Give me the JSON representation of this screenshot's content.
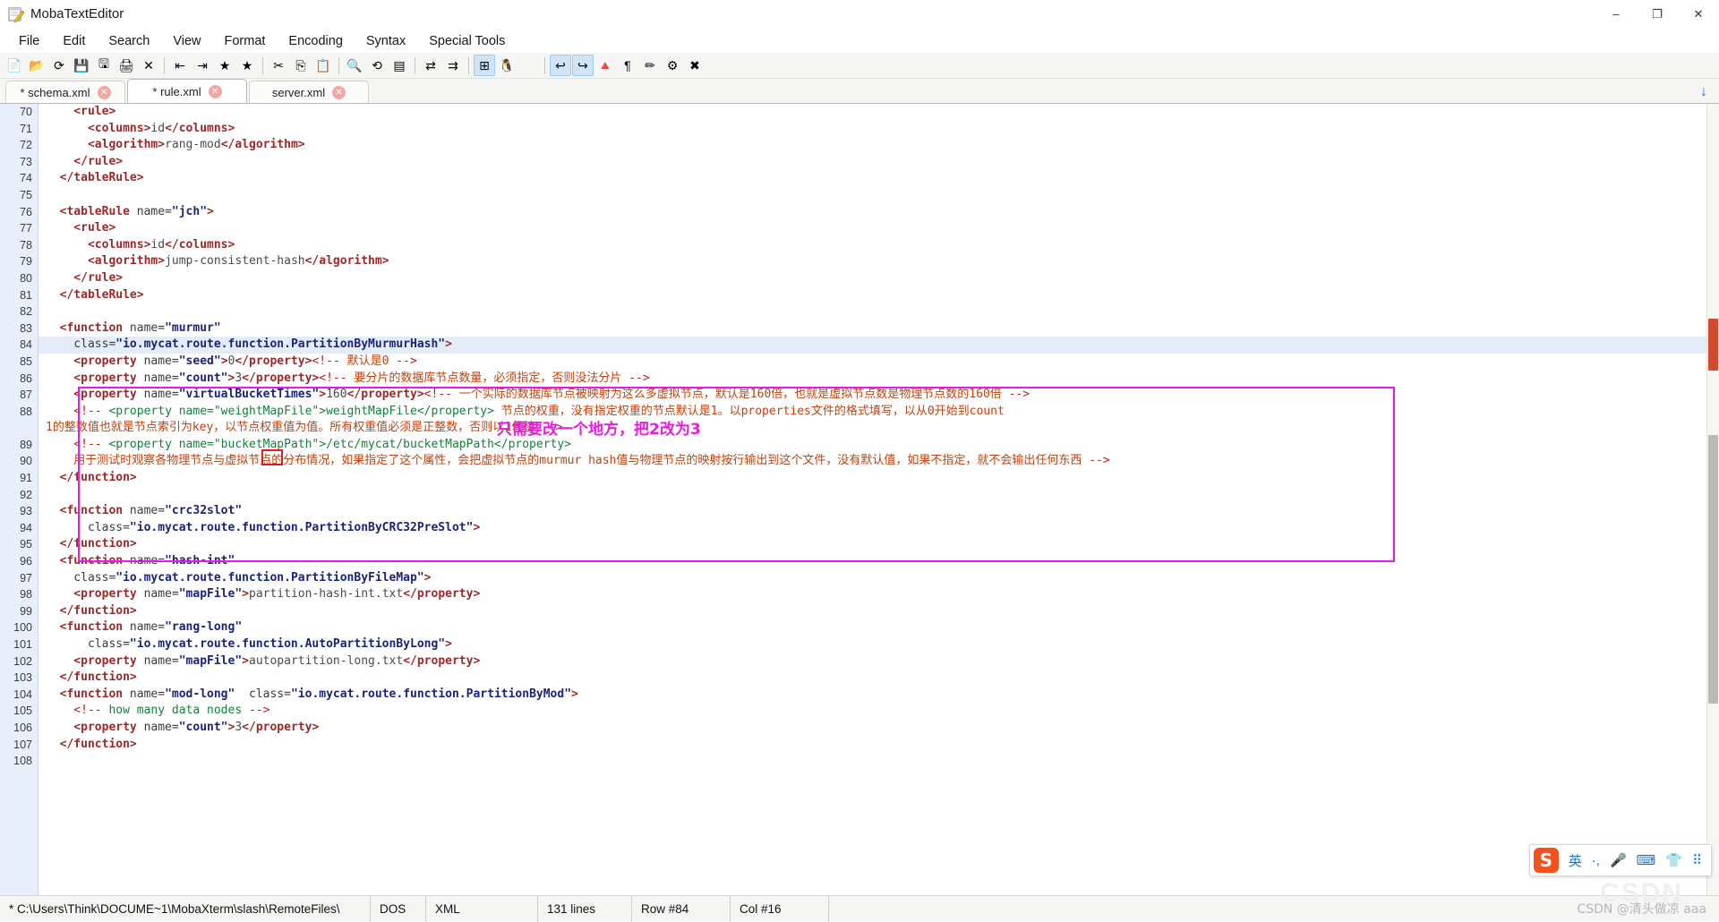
{
  "window": {
    "title": "MobaTextEditor",
    "icon": "notepad-pencil-icon",
    "minimize": "–",
    "maximize": "❐",
    "close": "✕"
  },
  "menubar": {
    "items": [
      "File",
      "Edit",
      "Search",
      "View",
      "Format",
      "Encoding",
      "Syntax",
      "Special Tools"
    ]
  },
  "toolbar": {
    "items": [
      {
        "name": "new-file-icon",
        "glyph": "📄",
        "selected": false
      },
      {
        "name": "open-folder-icon",
        "glyph": "📂",
        "selected": false
      },
      {
        "name": "reload-icon",
        "glyph": "⟳",
        "selected": false
      },
      {
        "name": "save-icon",
        "glyph": "💾",
        "selected": false
      },
      {
        "name": "save-as-icon",
        "glyph": "🖫",
        "selected": false
      },
      {
        "name": "print-icon",
        "glyph": "🖨",
        "selected": false
      },
      {
        "name": "close-file-icon",
        "glyph": "✕",
        "selected": false
      },
      {
        "name": "separator",
        "glyph": "",
        "selected": false
      },
      {
        "name": "decrease-indent-icon",
        "glyph": "⇤",
        "selected": false
      },
      {
        "name": "increase-indent-icon",
        "glyph": "⇥",
        "selected": false
      },
      {
        "name": "bookmark-toggle-icon",
        "glyph": "★",
        "selected": false
      },
      {
        "name": "bookmark-next-icon",
        "glyph": "★",
        "selected": false
      },
      {
        "name": "separator",
        "glyph": "",
        "selected": false
      },
      {
        "name": "cut-icon",
        "glyph": "✂",
        "selected": false
      },
      {
        "name": "copy-icon",
        "glyph": "⎘",
        "selected": false
      },
      {
        "name": "paste-icon",
        "glyph": "📋",
        "selected": false
      },
      {
        "name": "separator",
        "glyph": "",
        "selected": false
      },
      {
        "name": "find-icon",
        "glyph": "🔍",
        "selected": false
      },
      {
        "name": "replace-icon",
        "glyph": "⟲",
        "selected": false
      },
      {
        "name": "goto-line-icon",
        "glyph": "▤",
        "selected": false
      },
      {
        "name": "separator",
        "glyph": "",
        "selected": false
      },
      {
        "name": "compare-files-icon",
        "glyph": "⇄",
        "selected": false
      },
      {
        "name": "merge-files-icon",
        "glyph": "⇉",
        "selected": false
      },
      {
        "name": "separator",
        "glyph": "",
        "selected": false
      },
      {
        "name": "windows-format-icon",
        "glyph": "⊞",
        "selected": true
      },
      {
        "name": "linux-format-icon",
        "glyph": "🐧",
        "selected": false
      },
      {
        "name": "mac-format-icon",
        "glyph": "",
        "selected": false
      },
      {
        "name": "separator",
        "glyph": "",
        "selected": false
      },
      {
        "name": "undo-icon",
        "glyph": "↩",
        "selected": true
      },
      {
        "name": "redo-icon",
        "glyph": "↪",
        "selected": true
      },
      {
        "name": "color-picker-icon",
        "glyph": "🔺",
        "selected": false
      },
      {
        "name": "show-pilcrow-icon",
        "glyph": "¶",
        "selected": false
      },
      {
        "name": "highlight-pen-icon",
        "glyph": "✏",
        "selected": false
      },
      {
        "name": "settings-gear-icon",
        "glyph": "⚙",
        "selected": false
      },
      {
        "name": "exit-icon",
        "glyph": "✖",
        "selected": false
      }
    ]
  },
  "tabs": {
    "items": [
      {
        "label": "* schema.xml",
        "active": false,
        "closable": true
      },
      {
        "label": "* rule.xml",
        "active": true,
        "closable": true
      },
      {
        "label": "server.xml",
        "active": false,
        "closable": true
      }
    ],
    "download_icon": "↓"
  },
  "editor": {
    "first_line": 70,
    "lines": [
      {
        "n": 70,
        "current": false,
        "spans": [
          {
            "c": "t",
            "v": "    <rule>"
          }
        ]
      },
      {
        "n": 71,
        "current": false,
        "spans": [
          {
            "c": "t",
            "v": "      <columns>"
          },
          {
            "c": "txt",
            "v": "id"
          },
          {
            "c": "t",
            "v": "</columns>"
          }
        ]
      },
      {
        "n": 72,
        "current": false,
        "spans": [
          {
            "c": "t",
            "v": "      <algorithm>"
          },
          {
            "c": "txt",
            "v": "rang-mod"
          },
          {
            "c": "t",
            "v": "</algorithm>"
          }
        ]
      },
      {
        "n": 73,
        "current": false,
        "spans": [
          {
            "c": "t",
            "v": "    </rule>"
          }
        ]
      },
      {
        "n": 74,
        "current": false,
        "spans": [
          {
            "c": "t",
            "v": "  </tableRule>"
          }
        ]
      },
      {
        "n": 75,
        "current": false,
        "spans": [
          {
            "c": "plain",
            "v": ""
          }
        ]
      },
      {
        "n": 76,
        "current": false,
        "spans": [
          {
            "c": "t",
            "v": "  <tableRule "
          },
          {
            "c": "at",
            "v": "name="
          },
          {
            "c": "av",
            "v": "\"jch\""
          },
          {
            "c": "t",
            "v": ">"
          }
        ]
      },
      {
        "n": 77,
        "current": false,
        "spans": [
          {
            "c": "t",
            "v": "    <rule>"
          }
        ]
      },
      {
        "n": 78,
        "current": false,
        "spans": [
          {
            "c": "t",
            "v": "      <columns>"
          },
          {
            "c": "txt",
            "v": "id"
          },
          {
            "c": "t",
            "v": "</columns>"
          }
        ]
      },
      {
        "n": 79,
        "current": false,
        "spans": [
          {
            "c": "t",
            "v": "      <algorithm>"
          },
          {
            "c": "txt",
            "v": "jump-consistent-hash"
          },
          {
            "c": "t",
            "v": "</algorithm>"
          }
        ]
      },
      {
        "n": 80,
        "current": false,
        "spans": [
          {
            "c": "t",
            "v": "    </rule>"
          }
        ]
      },
      {
        "n": 81,
        "current": false,
        "spans": [
          {
            "c": "t",
            "v": "  </tableRule>"
          }
        ]
      },
      {
        "n": 82,
        "current": false,
        "spans": [
          {
            "c": "plain",
            "v": ""
          }
        ]
      },
      {
        "n": 83,
        "current": false,
        "spans": [
          {
            "c": "t",
            "v": "  <function "
          },
          {
            "c": "at",
            "v": "name="
          },
          {
            "c": "av",
            "v": "\"murmur\""
          }
        ]
      },
      {
        "n": 84,
        "current": true,
        "spans": [
          {
            "c": "at",
            "v": "    class="
          },
          {
            "c": "av",
            "v": "\"io.mycat.route.function.PartitionByMurmurHash\""
          },
          {
            "c": "t",
            "v": ">"
          }
        ]
      },
      {
        "n": 85,
        "current": false,
        "spans": [
          {
            "c": "t",
            "v": "    <property "
          },
          {
            "c": "at",
            "v": "name="
          },
          {
            "c": "av",
            "v": "\"seed\""
          },
          {
            "c": "t",
            "v": ">"
          },
          {
            "c": "txt",
            "v": "0"
          },
          {
            "c": "t",
            "v": "</property>"
          },
          {
            "c": "cmd",
            "v": "<!--"
          },
          {
            "c": "cm",
            "v": " 默认是0 "
          },
          {
            "c": "cmd",
            "v": "-->"
          }
        ]
      },
      {
        "n": 86,
        "current": false,
        "spans": [
          {
            "c": "t",
            "v": "    <property "
          },
          {
            "c": "at",
            "v": "name="
          },
          {
            "c": "av",
            "v": "\"count\""
          },
          {
            "c": "t",
            "v": ">"
          },
          {
            "c": "txt",
            "v": "3"
          },
          {
            "c": "t",
            "v": "</property>"
          },
          {
            "c": "cmd",
            "v": "<!--"
          },
          {
            "c": "cm",
            "v": " 要分片的数据库节点数量，必须指定，否则没法分片 "
          },
          {
            "c": "cmd",
            "v": "-->"
          }
        ]
      },
      {
        "n": 87,
        "current": false,
        "spans": [
          {
            "c": "t",
            "v": "    <property "
          },
          {
            "c": "at",
            "v": "name="
          },
          {
            "c": "av",
            "v": "\"virtualBucketTimes\""
          },
          {
            "c": "t",
            "v": ">"
          },
          {
            "c": "txt",
            "v": "160"
          },
          {
            "c": "t",
            "v": "</property>"
          },
          {
            "c": "cmd",
            "v": "<!--"
          },
          {
            "c": "cm",
            "v": " 一个实际的数据库节点被映射为这么多虚拟节点，默认是160倍，也就是虚拟节点数是物理节点数的160倍 "
          },
          {
            "c": "cmd",
            "v": "-->"
          }
        ]
      },
      {
        "n": 88,
        "current": false,
        "spans": [
          {
            "c": "cmd",
            "v": "    <!-- "
          },
          {
            "c": "cmg",
            "v": "<property name=\"weightMapFile\">weightMapFile</property>"
          },
          {
            "c": "cm",
            "v": " 节点的权重，没有指定权重的节点默认是1。以properties文件的格式填写，以从0开始到count"
          }
        ]
      },
      {
        "n": null,
        "current": false,
        "wrap": true,
        "spans": [
          {
            "c": "cm",
            "v": "1的整数值也就是节点索引为key，以节点权重值为值。所有权重值必须是正整数，否则以1代替 "
          },
          {
            "c": "cmd",
            "v": "-->"
          }
        ]
      },
      {
        "n": 89,
        "current": false,
        "spans": [
          {
            "c": "cmd",
            "v": "    <!-- "
          },
          {
            "c": "cmg",
            "v": "<property name=\"bucketMapPath\">/etc/mycat/bucketMapPath</property>"
          }
        ]
      },
      {
        "n": 90,
        "current": false,
        "spans": [
          {
            "c": "cm",
            "v": "    用于测试时观察各物理节点与虚拟节点的分布情况，如果指定了这个属性，会把虚拟节点的murmur hash值与物理节点的映射按行输出到这个文件，没有默认值，如果不指定，就不会输出任何东西 "
          },
          {
            "c": "cmd",
            "v": "-->"
          }
        ]
      },
      {
        "n": 91,
        "current": false,
        "spans": [
          {
            "c": "t",
            "v": "  </function>"
          }
        ]
      },
      {
        "n": 92,
        "current": false,
        "spans": [
          {
            "c": "plain",
            "v": ""
          }
        ]
      },
      {
        "n": 93,
        "current": false,
        "spans": [
          {
            "c": "t",
            "v": "  <function "
          },
          {
            "c": "at",
            "v": "name="
          },
          {
            "c": "av",
            "v": "\"crc32slot\""
          }
        ]
      },
      {
        "n": 94,
        "current": false,
        "spans": [
          {
            "c": "at",
            "v": "      class="
          },
          {
            "c": "av",
            "v": "\"io.mycat.route.function.PartitionByCRC32PreSlot\""
          },
          {
            "c": "t",
            "v": ">"
          }
        ]
      },
      {
        "n": 95,
        "current": false,
        "spans": [
          {
            "c": "t",
            "v": "  </function>"
          }
        ]
      },
      {
        "n": 96,
        "current": false,
        "spans": [
          {
            "c": "t",
            "v": "  <function "
          },
          {
            "c": "at",
            "v": "name="
          },
          {
            "c": "av",
            "v": "\"hash-int\""
          }
        ]
      },
      {
        "n": 97,
        "current": false,
        "spans": [
          {
            "c": "at",
            "v": "    class="
          },
          {
            "c": "av",
            "v": "\"io.mycat.route.function.PartitionByFileMap\""
          },
          {
            "c": "t",
            "v": ">"
          }
        ]
      },
      {
        "n": 98,
        "current": false,
        "spans": [
          {
            "c": "t",
            "v": "    <property "
          },
          {
            "c": "at",
            "v": "name="
          },
          {
            "c": "av",
            "v": "\"mapFile\""
          },
          {
            "c": "t",
            "v": ">"
          },
          {
            "c": "txt",
            "v": "partition-hash-int.txt"
          },
          {
            "c": "t",
            "v": "</property>"
          }
        ]
      },
      {
        "n": 99,
        "current": false,
        "spans": [
          {
            "c": "t",
            "v": "  </function>"
          }
        ]
      },
      {
        "n": 100,
        "current": false,
        "spans": [
          {
            "c": "t",
            "v": "  <function "
          },
          {
            "c": "at",
            "v": "name="
          },
          {
            "c": "av",
            "v": "\"rang-long\""
          }
        ]
      },
      {
        "n": 101,
        "current": false,
        "spans": [
          {
            "c": "at",
            "v": "      class="
          },
          {
            "c": "av",
            "v": "\"io.mycat.route.function.AutoPartitionByLong\""
          },
          {
            "c": "t",
            "v": ">"
          }
        ]
      },
      {
        "n": 102,
        "current": false,
        "spans": [
          {
            "c": "t",
            "v": "    <property "
          },
          {
            "c": "at",
            "v": "name="
          },
          {
            "c": "av",
            "v": "\"mapFile\""
          },
          {
            "c": "t",
            "v": ">"
          },
          {
            "c": "txt",
            "v": "autopartition-long.txt"
          },
          {
            "c": "t",
            "v": "</property>"
          }
        ]
      },
      {
        "n": 103,
        "current": false,
        "spans": [
          {
            "c": "t",
            "v": "  </function>"
          }
        ]
      },
      {
        "n": 104,
        "current": false,
        "spans": [
          {
            "c": "t",
            "v": "  <function "
          },
          {
            "c": "at",
            "v": "name="
          },
          {
            "c": "av",
            "v": "\"mod-long\""
          },
          {
            "c": "at",
            "v": "  class="
          },
          {
            "c": "av",
            "v": "\"io.mycat.route.function.PartitionByMod\""
          },
          {
            "c": "t",
            "v": ">"
          }
        ]
      },
      {
        "n": 105,
        "current": false,
        "spans": [
          {
            "c": "cmd",
            "v": "    <!-- "
          },
          {
            "c": "cmg",
            "v": "how many data nodes"
          },
          {
            "c": "cmd",
            "v": " -->"
          }
        ]
      },
      {
        "n": 106,
        "current": false,
        "spans": [
          {
            "c": "t",
            "v": "    <property "
          },
          {
            "c": "at",
            "v": "name="
          },
          {
            "c": "av",
            "v": "\"count\""
          },
          {
            "c": "t",
            "v": ">"
          },
          {
            "c": "txt",
            "v": "3"
          },
          {
            "c": "t",
            "v": "</property>"
          }
        ]
      },
      {
        "n": 107,
        "current": false,
        "spans": [
          {
            "c": "t",
            "v": "  </function>"
          }
        ]
      },
      {
        "n": 108,
        "current": false,
        "spans": [
          {
            "c": "plain",
            "v": ""
          }
        ]
      }
    ],
    "annotation": {
      "text": "只需要改一个地方，把2改为3",
      "color": "#ea1ae0",
      "box_color": "#e619e6",
      "highlight_value_box_color": "#e01b1b"
    }
  },
  "status": {
    "path": "* C:\\Users\\Think\\DOCUME~1\\MobaXterm\\slash\\RemoteFiles\\",
    "line_ending": "DOS",
    "syntax": "XML",
    "lines": "131 lines",
    "row": "Row #84",
    "col": "Col #16"
  },
  "ime": {
    "logo": "S",
    "items": [
      "英",
      "·,",
      "🎤",
      "⌨",
      "👕",
      "⠿"
    ]
  },
  "watermark": {
    "text": "CSDN @清头做凉 aaa",
    "ghost": "CSDN"
  }
}
